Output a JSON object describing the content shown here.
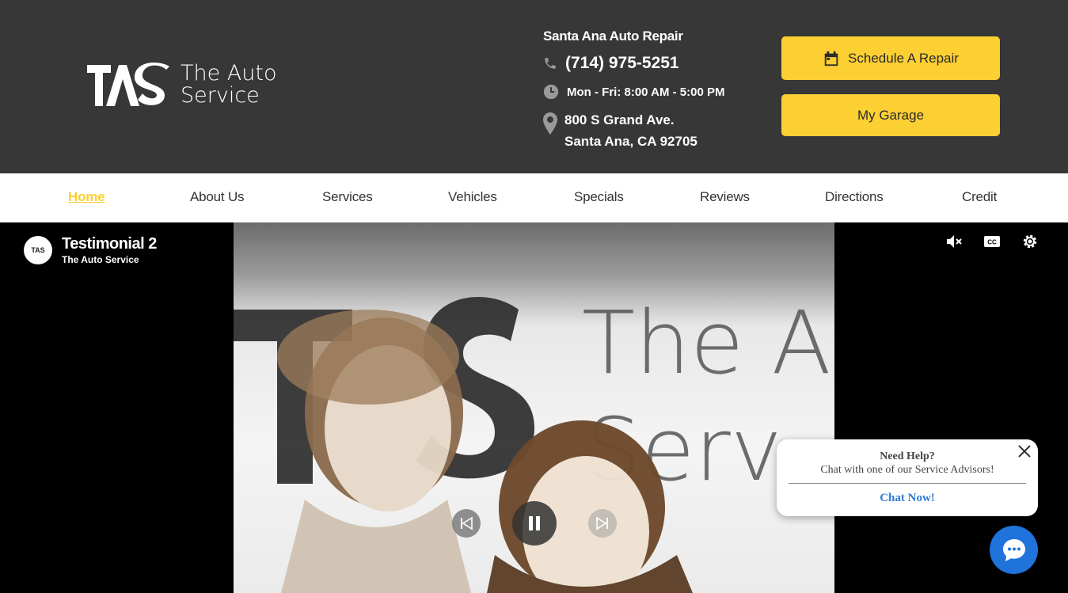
{
  "header": {
    "logo": {
      "mark": "TAS",
      "line1": "The Auto",
      "line2": "Service"
    },
    "contact": {
      "shop_name": "Santa Ana Auto Repair",
      "phone": "(714) 975-5251",
      "hours": "Mon - Fri: 8:00 AM - 5:00 PM",
      "address_line1": "800 S Grand Ave.",
      "address_line2": "Santa Ana, CA 92705"
    },
    "buttons": {
      "schedule": "Schedule A Repair",
      "garage": "My Garage"
    }
  },
  "nav": {
    "items": [
      {
        "label": "Home",
        "active": true
      },
      {
        "label": "About Us"
      },
      {
        "label": "Services"
      },
      {
        "label": "Vehicles"
      },
      {
        "label": "Specials"
      },
      {
        "label": "Reviews"
      },
      {
        "label": "Directions"
      },
      {
        "label": "Credit"
      }
    ]
  },
  "video": {
    "title": "Testimonial 2",
    "channel": "The Auto Service",
    "avatar": "TAS",
    "controls": [
      "mute-icon",
      "captions-icon",
      "settings-icon",
      "previous-icon",
      "pause-icon",
      "next-icon"
    ]
  },
  "chat": {
    "heading": "Need Help?",
    "subtext": "Chat with one of our Service Advisors!",
    "cta": "Chat Now!"
  },
  "colors": {
    "header_bg": "#373737",
    "accent": "#fccf33",
    "chat_blue": "#1f73db"
  }
}
